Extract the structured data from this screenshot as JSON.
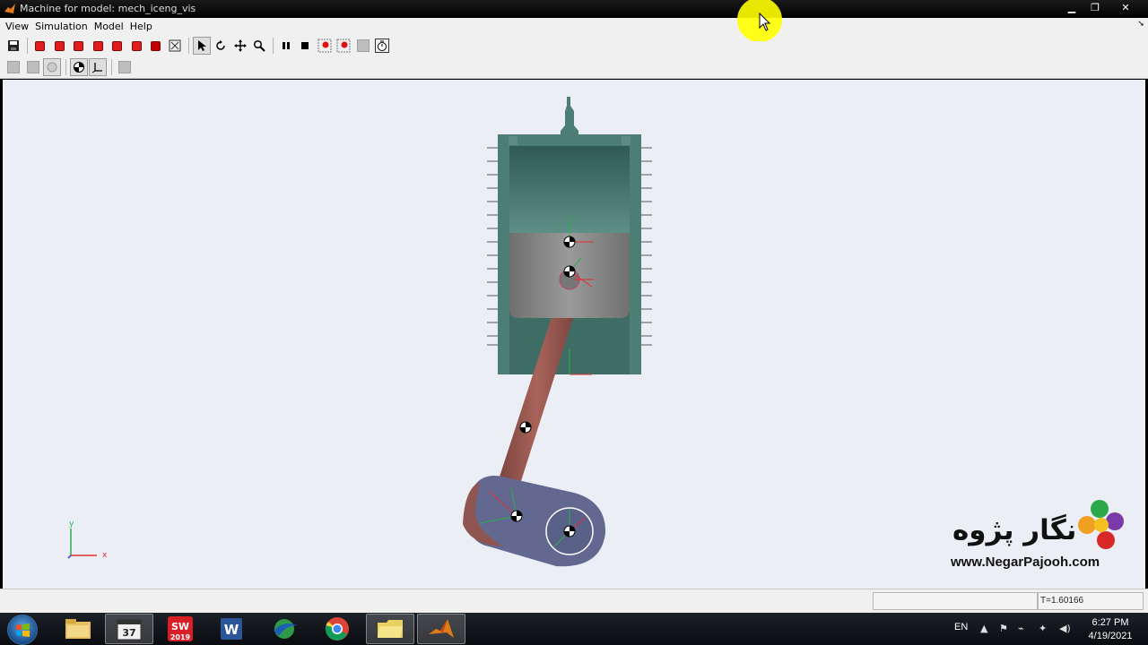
{
  "window": {
    "title": "Machine for model: mech_iceng_vis",
    "buttons": [
      "minimize",
      "restore",
      "close"
    ]
  },
  "menu": {
    "items": [
      "View",
      "Simulation",
      "Model",
      "Help"
    ]
  },
  "toolbar": {
    "save_icon": "save-icon",
    "view_buttons": [
      "view-1-icon",
      "view-2-icon",
      "view-3-icon",
      "view-4-icon",
      "view-5-icon",
      "view-6-icon",
      "view-7-icon"
    ],
    "tools": [
      "select-arrow-icon",
      "rotate-icon",
      "pan-icon",
      "zoom-icon"
    ],
    "sim_controls": [
      "pause-icon",
      "stop-icon",
      "record-icon",
      "record-alt-icon",
      "disabled-icon",
      "timer-icon"
    ]
  },
  "toolbar2": {
    "items": [
      "grey-1-icon",
      "grey-2-icon",
      "grey-3-icon",
      "cg-marker-icon",
      "axes-frame-icon",
      "grey-4-icon"
    ]
  },
  "viewport": {
    "axis_labels": {
      "x": "x",
      "y": "y"
    },
    "colors": {
      "cylinder": "#4a7a72",
      "piston": "#8f8f8f",
      "rod": "#9a5a52",
      "crank": "#62688f"
    }
  },
  "watermark": {
    "name": "نگار پژوه",
    "url": "www.NegarPajooh.com"
  },
  "status": {
    "field": "",
    "time": "T=1.60166"
  },
  "taskbar": {
    "apps": [
      "file-explorer-icon",
      "video-editor-icon",
      "solidworks-icon",
      "word-icon",
      "download-manager-icon",
      "chrome-icon",
      "folder-icon",
      "matlab-icon"
    ],
    "solidworks_label": "SW",
    "solidworks_year": "2019",
    "video_badge": "37",
    "language": "EN",
    "time": "6:27 PM",
    "date": "4/19/2021"
  }
}
